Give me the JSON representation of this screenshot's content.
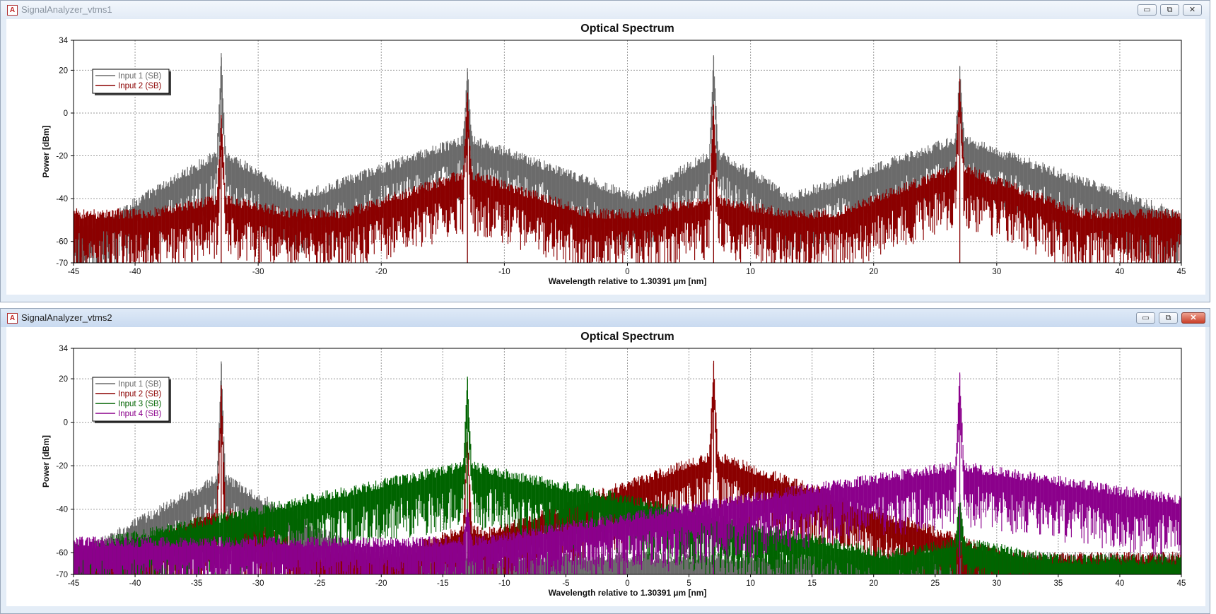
{
  "windows": [
    {
      "title": "SignalAnalyzer_vtms1",
      "controls": {
        "minimize": "▭",
        "restore": "⧉",
        "close": "✕"
      }
    },
    {
      "title": "SignalAnalyzer_vtms2",
      "controls": {
        "minimize": "▭",
        "restore": "⧉",
        "close": "✕"
      }
    }
  ],
  "colors": {
    "input1": "#6b6b6b",
    "input2": "#8b0000",
    "input3": "#006400",
    "input4": "#8b008b"
  },
  "chart_data": [
    {
      "type": "line",
      "title": "Optical Spectrum",
      "xlabel": "Wavelength relative to 1.30391 µm [nm]",
      "ylabel": "Power [dBm]",
      "xlim": [
        -45,
        45
      ],
      "ylim": [
        -70,
        34
      ],
      "x_ticks": [
        "-45",
        "-40",
        "-30",
        "-20",
        "-10",
        "0",
        "10",
        "20",
        "30",
        "40",
        "45"
      ],
      "y_ticks": [
        "34",
        "20",
        "0",
        "-20",
        "-40",
        "-60",
        "-70"
      ],
      "grid": true,
      "legend_position": "top-left",
      "series": [
        {
          "name": "Input 1 (SB)",
          "color": "#6b6b6b",
          "peaks": [
            {
              "x": -33,
              "peak": 28,
              "pedestal": -18,
              "width": 2.5
            },
            {
              "x": -13,
              "peak": 21,
              "pedestal": -12,
              "width": 5
            },
            {
              "x": 7,
              "peak": 27,
              "pedestal": -18,
              "width": 2.5
            },
            {
              "x": 27,
              "peak": 22,
              "pedestal": -12,
              "width": 5
            }
          ],
          "floor": -52
        },
        {
          "name": "Input 2 (SB)",
          "color": "#8b0000",
          "peaks": [
            {
              "x": -33,
              "peak": -1,
              "pedestal": -40,
              "width": 1.5
            },
            {
              "x": -13,
              "peak": 9,
              "pedestal": -28,
              "width": 2.5
            },
            {
              "x": 7,
              "peak": 4,
              "pedestal": -40,
              "width": 1.5
            },
            {
              "x": 27,
              "peak": 15,
              "pedestal": -25,
              "width": 2.5
            }
          ],
          "floor": -47
        }
      ]
    },
    {
      "type": "line",
      "title": "Optical Spectrum",
      "xlabel": "Wavelength relative to 1.30391 µm [nm]",
      "ylabel": "Power [dBm]",
      "xlim": [
        -45,
        45
      ],
      "ylim": [
        -70,
        34
      ],
      "x_ticks": [
        "-45",
        "-40",
        "-35",
        "-30",
        "-25",
        "-20",
        "-15",
        "-10",
        "-5",
        "0",
        "5",
        "10",
        "15",
        "20",
        "25",
        "30",
        "35",
        "40",
        "45"
      ],
      "y_ticks": [
        "34",
        "20",
        "0",
        "-20",
        "-40",
        "-60",
        "-70"
      ],
      "grid": true,
      "legend_position": "top-left",
      "series": [
        {
          "name": "Input 1 (SB)",
          "color": "#6b6b6b",
          "peaks": [
            {
              "x": -33,
              "peak": 28,
              "pedestal": -25,
              "width": 3
            }
          ],
          "floor": -62
        },
        {
          "name": "Input 2 (SB)",
          "color": "#8b0000",
          "peaks": [
            {
              "x": -33,
              "peak": 17,
              "pedestal": -40,
              "width": 2
            },
            {
              "x": -13,
              "peak": -5,
              "pedestal": -48,
              "width": 1.5
            },
            {
              "x": 7,
              "peak": 27,
              "pedestal": -15,
              "width": 6
            }
          ],
          "floor": -62
        },
        {
          "name": "Input 3 (SB)",
          "color": "#006400",
          "peaks": [
            {
              "x": -13,
              "peak": 21,
              "pedestal": -20,
              "width": 9
            },
            {
              "x": 27,
              "peak": -33,
              "pedestal": -55,
              "width": 2
            }
          ],
          "floor": -63
        },
        {
          "name": "Input 4 (SB)",
          "color": "#8b008b",
          "peaks": [
            {
              "x": 27,
              "peak": 22,
              "pedestal": -20,
              "width": 10
            },
            {
              "x": 7,
              "peak": -35,
              "pedestal": -50,
              "width": 1
            },
            {
              "x": -13,
              "peak": -40,
              "pedestal": -55,
              "width": 1
            }
          ],
          "floor": -55
        }
      ]
    }
  ]
}
